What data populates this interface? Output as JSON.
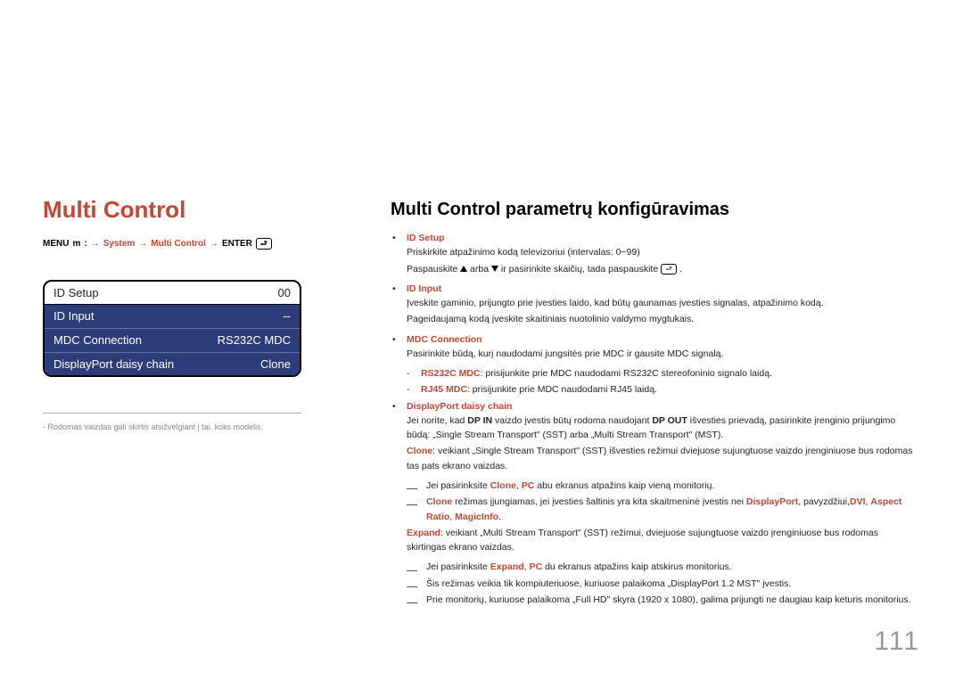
{
  "left": {
    "title": "Multi Control",
    "menuPath": {
      "menu": "MENU",
      "m": "m",
      "sep": ":",
      "system": "System",
      "multiControl": "Multi Control",
      "enter": "ENTER"
    },
    "osd": [
      {
        "label": "ID Setup",
        "value": "00",
        "style": "plain"
      },
      {
        "label": "ID Input",
        "value": "--",
        "style": "inv"
      },
      {
        "label": "MDC Connection",
        "value": "RS232C MDC",
        "style": "inv"
      },
      {
        "label": "DisplayPort daisy chain",
        "value": "Clone",
        "style": "inv"
      }
    ],
    "footnote": "- Rodomas vaizdas gali skirtis atsižvelgiant į tai, koks modelis."
  },
  "right": {
    "heading": "Multi Control parametrų konfigūravimas",
    "idSetup": {
      "term": "ID Setup",
      "line1a": "Priskirkite atpažinimo kodą televizoriui (intervalas: 0~99)",
      "line2a": "Paspauskite ",
      "line2b": " arba ",
      "line2c": " ir pasirinkite skaičių, tada paspauskite ",
      "line2d": "."
    },
    "idInput": {
      "term": "ID Input",
      "line1": "Įveskite gaminio, prijungto prie įvesties laido, kad būtų gaunamas įvesties signalas, atpažinimo kodą.",
      "line2": "Pageidaujamą kodą įveskite skaitiniais nuotolinio valdymo mygtukais."
    },
    "mdc": {
      "term": "MDC Connection",
      "line1": "Pasirinkite būdą, kurį naudodami jungsitės prie MDC ir gausite MDC signalą.",
      "rs232": {
        "label": "RS232C MDC",
        "text": ": prisijunkite prie MDC naudodami RS232C stereofoninio signalo laidą."
      },
      "rj45": {
        "label": "RJ45 MDC",
        "text": ": prisijunkite prie MDC naudodami RJ45 laidą."
      }
    },
    "dp": {
      "term": "DisplayPort daisy chain",
      "line1a": "Jei norite, kad ",
      "line1b": "DP IN",
      "line1c": " vaizdo įvestis būtų rodoma naudojant ",
      "line1d": "DP OUT",
      "line1e": " išvesties prievadą, pasirinkite įrenginio prijungimo būdą: „Single Stream Transport\" (SST) arba „Multi Stream Transport\" (MST).",
      "clone": {
        "label": "Clone",
        "text": ": veikiant „Single Stream Transport\" (SST) išvesties režimui dviejuose sujungtuose vaizdo įrenginiuose bus rodomas tas pats ekrano vaizdas."
      },
      "cloneNote1a": "Jei pasirinksite ",
      "cloneNote1b": "Clone",
      "cloneNote1c": ", ",
      "cloneNote1d": "PC",
      "cloneNote1e": " abu ekranus atpažins kaip vieną monitorių.",
      "cloneNote2a": "Clone",
      "cloneNote2b": " režimas įjungiamas, jei įvesties šaltinis yra kita skaitmeninė įvestis nei ",
      "cloneNote2c": "DisplayPort",
      "cloneNote2d": ", pavyzdžiui,",
      "cloneNote2e": "DVI",
      "cloneNote2f": ", ",
      "cloneNote2g": "Aspect Ratio",
      "cloneNote2h": ", ",
      "cloneNote2i": "MagicInfo",
      "cloneNote2j": ".",
      "expand": {
        "label": "Expand",
        "text": ": veikiant „Multi Stream Transport\" (SST) režimui, dviejuose sujungtuose vaizdo įrenginiuose bus rodomas skirtingas ekrano vaizdas."
      },
      "expandNote1a": "Jei pasirinksite ",
      "expandNote1b": "Expand",
      "expandNote1c": ", ",
      "expandNote1d": "PC",
      "expandNote1e": " du ekranus atpažins kaip atskirus monitorius.",
      "expandNote2": "Šis režimas veikia tik kompiuteriuose, kuriuose palaikoma „DisplayPort 1.2 MST\" įvestis.",
      "expandNote3": "Prie monitorių, kuriuose palaikoma „Full HD\" skyra (1920 x 1080), galima prijungti ne daugiau kaip keturis monitorius."
    }
  },
  "pageNumber": "111"
}
